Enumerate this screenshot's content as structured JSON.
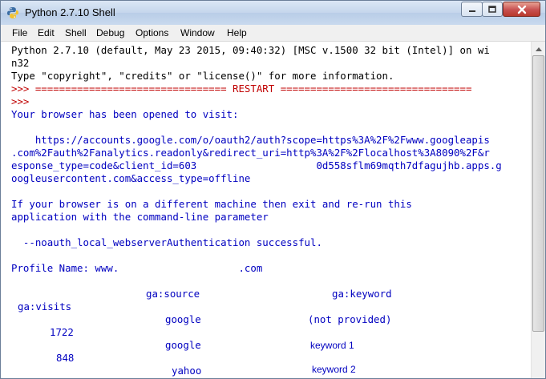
{
  "window": {
    "title": "Python 2.7.10 Shell"
  },
  "menu": [
    "File",
    "Edit",
    "Shell",
    "Debug",
    "Options",
    "Window",
    "Help"
  ],
  "shell": {
    "banner1": "Python 2.7.10 (default, May 23 2015, 09:40:32) [MSC v.1500 32 bit (Intel)] on wi",
    "banner2": "n32",
    "banner3": "Type \"copyright\", \"credits\" or \"license()\" for more information.",
    "restart": ">>> ================================ RESTART ================================",
    "prompt": ">>>",
    "opened": "Your browser has been opened to visit:",
    "url1": "    https://accounts.google.com/o/oauth2/auth?scope=https%3A%2F%2Fwww.googleapis",
    "url2": ".com%2Fauth%2Fanalytics.readonly&redirect_uri=http%3A%2F%2Flocalhost%3A8090%2F&r",
    "url3": "esponse_type=code&client_id=603                    0d558sflm69mqth7dfagujhb.apps.g",
    "url4": "oogleusercontent.com&access_type=offline",
    "diff1": "If your browser is on a different machine then exit and re-run this",
    "diff2": "application with the command-line parameter",
    "noauth": "  --noauth_local_webserverAuthentication successful.",
    "profile": "Profile Name: www.                    .com",
    "header_source": "ga:source",
    "header_keyword": "ga:keyword",
    "header_visits": "ga:visits",
    "rows": [
      {
        "source": "google",
        "keyword": "(not provided)",
        "visits": "1722"
      },
      {
        "source": "google",
        "keyword": "keyword 1",
        "visits": "848"
      },
      {
        "source": "yahoo",
        "keyword": "keyword 2",
        "visits": ""
      }
    ]
  }
}
